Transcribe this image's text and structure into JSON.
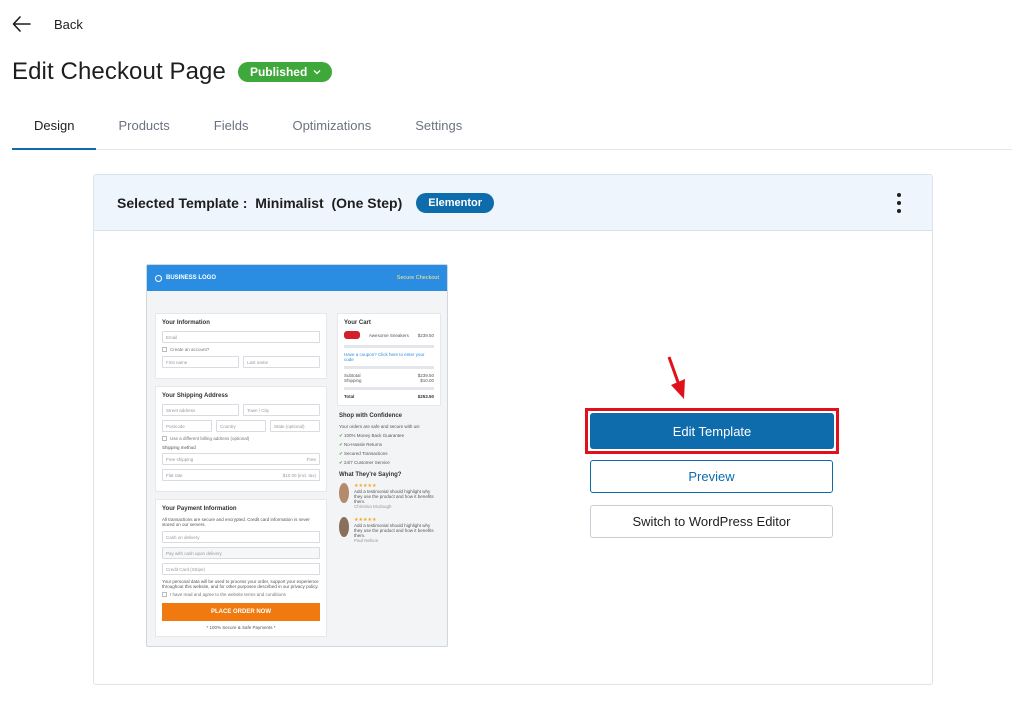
{
  "nav": {
    "back_label": "Back"
  },
  "page": {
    "title": "Edit Checkout Page",
    "status": "Published"
  },
  "tabs": [
    {
      "label": "Design",
      "active": true
    },
    {
      "label": "Products",
      "active": false
    },
    {
      "label": "Fields",
      "active": false
    },
    {
      "label": "Optimizations",
      "active": false
    },
    {
      "label": "Settings",
      "active": false
    }
  ],
  "template": {
    "selected_label": "Selected Template :  Minimalist  (One Step)",
    "builder_badge": "Elementor"
  },
  "preview": {
    "logo": "BUSINESS LOGO",
    "secure": "Secure Checkout",
    "your_information": "Your Information",
    "email": "Email",
    "create_account": "Create an account?",
    "first_name": "First name",
    "last_name": "Last name",
    "shipping_address": "Your Shipping Address",
    "street": "Street address",
    "town": "Town / City",
    "postcode": "Postcode",
    "country": "Country",
    "state": "State (optional)",
    "different_billing": "Use a different billing address (optional)",
    "shipping_method": "Shipping method",
    "free_shipping": "Free shipping",
    "free": "Free",
    "flat_rate": "Flat rate",
    "flat_price": "$10.00 (incl. tax)",
    "payment_info": "Your Payment Information",
    "payment_note": "All transactions are secure and encrypted. Credit card information is never stored on our servers.",
    "cash_on_delivery": "Cash on delivery",
    "pay_with_cash": "Pay with cash upon delivery",
    "credit_card": "Credit Card (Stripe)",
    "privacy": "Your personal data will be used to process your order, support your experience throughout this website, and for other purposes described in our privacy policy.",
    "terms": "I have read and agree to the website terms and conditions",
    "place_order": "PLACE ORDER NOW",
    "secure_payments": "* 100% Secure & Safe Payments *",
    "your_cart": "Your Cart",
    "product": "Awesome Sneakers",
    "product_price": "$239.50",
    "coupon": "Have a coupon? Click here to enter your code",
    "subtotal": "Subtotal",
    "subtotal_val": "$239.50",
    "shipping": "Shipping",
    "shipping_val": "$10.00",
    "total": "Total",
    "total_val": "$253.50",
    "shop_confidence": "Shop with Confidence",
    "safe_secure": "Your orders are safe and secure with us!",
    "guarantees": [
      "100% Money Back Guarantee",
      "No-Hassle Returns",
      "Secured Transactions",
      "24/7 Customer Service"
    ],
    "what_saying": "What They're Saying?",
    "testimonial": "Add a testimonial should highlight why they use the product and how it benefits them.",
    "reviewer_1": "Christina Mcdough",
    "reviewer_2": "Paul Nelson",
    "stars": "★★★★★"
  },
  "actions": {
    "edit_template": "Edit Template",
    "preview": "Preview",
    "switch_editor": "Switch to WordPress Editor"
  },
  "colors": {
    "primary": "#0e6cad",
    "published": "#3fa83a",
    "highlight": "#e0111a",
    "order_button": "#f07a10",
    "preview_header": "#2b8de2"
  }
}
